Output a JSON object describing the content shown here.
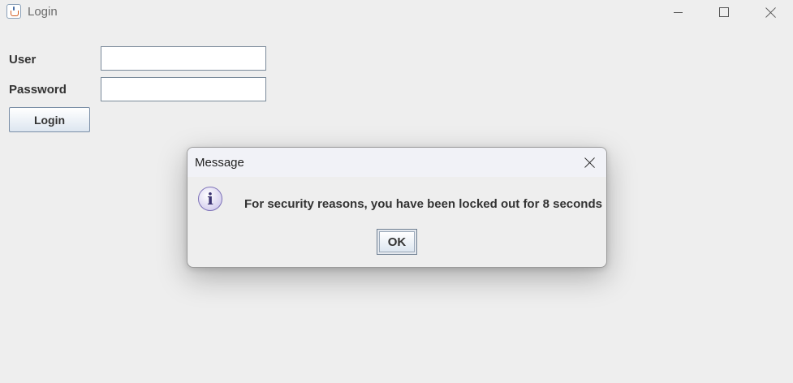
{
  "window": {
    "title": "Login",
    "app_icon": "java-cup-icon",
    "controls": {
      "minimize": "minimize-icon",
      "maximize": "maximize-icon",
      "close": "close-icon"
    }
  },
  "form": {
    "user_label": "User",
    "user_value": "",
    "password_label": "Password",
    "password_value": "",
    "login_button": "Login"
  },
  "dialog": {
    "title": "Message",
    "icon": "info-icon",
    "icon_glyph": "i",
    "message": "For security reasons, you have been locked out for 8 seconds",
    "ok_button": "OK"
  }
}
